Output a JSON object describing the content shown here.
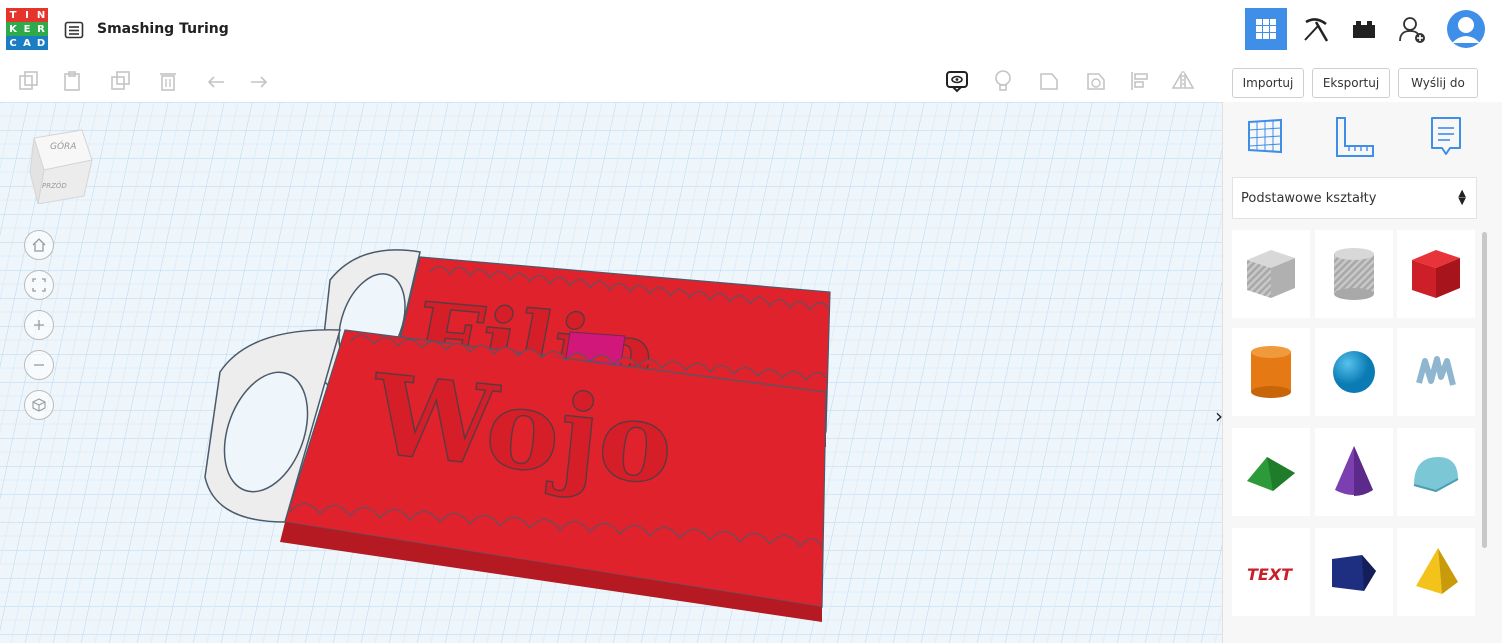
{
  "app": {
    "logo_letters": [
      "T",
      "I",
      "N",
      "K",
      "E",
      "R",
      "C",
      "A",
      "D"
    ],
    "logo_colors": [
      "#e5352b",
      "#e5352b",
      "#e5352b",
      "#2eaa4a",
      "#2eaa4a",
      "#2eaa4a",
      "#1b7ec2",
      "#1b7ec2",
      "#1b7ec2"
    ],
    "project_title": "Smashing Turing"
  },
  "topbar": {
    "icons": [
      "grid-view-icon",
      "pickaxe-icon",
      "brick-icon",
      "add-user-icon",
      "avatar"
    ],
    "active_color": "#3f8ee8"
  },
  "toolbar": {
    "left_icons": [
      "copy-icon",
      "paste-icon",
      "duplicate-icon",
      "delete-icon",
      "undo-icon",
      "redo-icon"
    ],
    "right_icons": [
      "notes-icon",
      "light-bulb-icon",
      "shape-icon",
      "hole-icon",
      "align-icon",
      "mirror-icon"
    ],
    "import_label": "Importuj",
    "export_label": "Eksportuj",
    "send_label": "Wyślij do"
  },
  "viewcube": {
    "top": "GÓRA",
    "front": "PRZÓD"
  },
  "scene": {
    "keychain_top_text": "Filip",
    "keychain_bottom_text": "Wojo",
    "red": "#e0222c",
    "white": "#ededed",
    "magenta": "#d2177a",
    "grid_blue": "#9fcbeb"
  },
  "sidepanel": {
    "tabs": [
      "workplane-icon",
      "ruler-icon",
      "notes-icon"
    ],
    "category_label": "Podstawowe kształty",
    "collapse_label": "›",
    "shapes": [
      "box-hole",
      "cylinder-hole",
      "box",
      "cylinder",
      "sphere",
      "scribble",
      "roof",
      "cone",
      "round-roof",
      "text",
      "polygon",
      "pyramid"
    ]
  }
}
